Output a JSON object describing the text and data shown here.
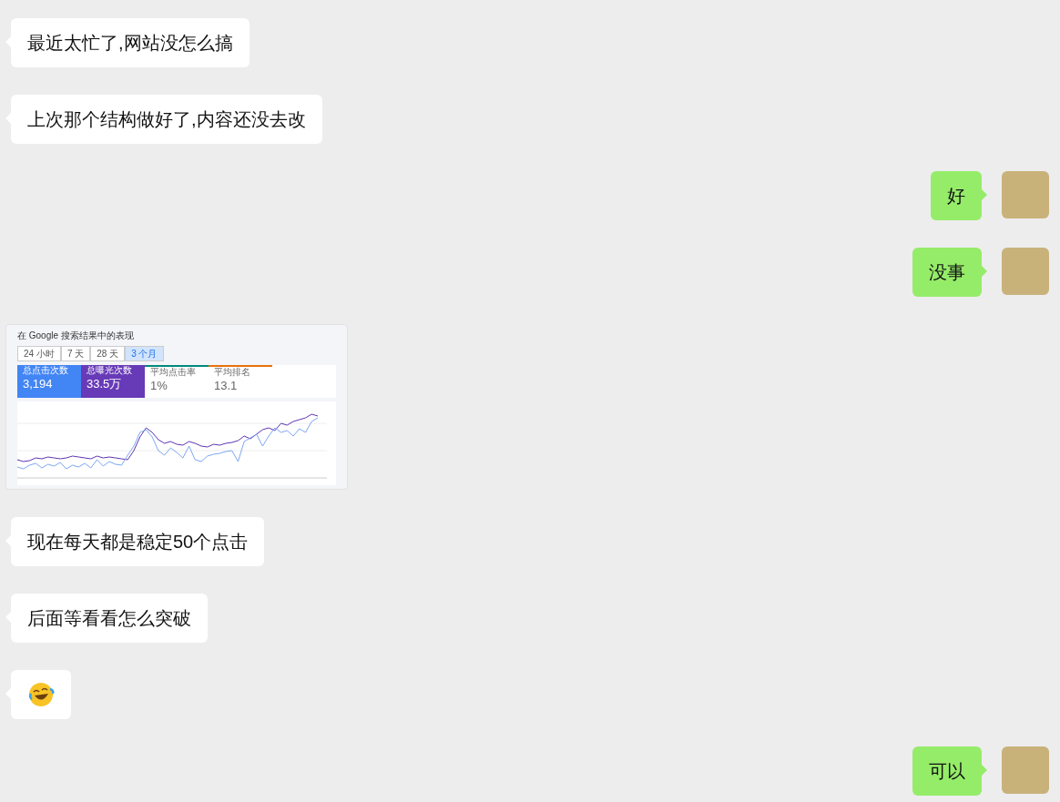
{
  "messages": [
    {
      "kind": "text",
      "sent": false,
      "text": "最近太忙了,网站没怎么搞"
    },
    {
      "kind": "text",
      "sent": false,
      "text": "上次那个结构做好了,内容还没去改"
    },
    {
      "kind": "text",
      "sent": true,
      "text": "好"
    },
    {
      "kind": "text",
      "sent": true,
      "text": "没事"
    },
    {
      "kind": "image",
      "sent": false,
      "shot": {
        "title": "在 Google 搜索结果中的表现",
        "ranges": [
          {
            "label": "24 小时",
            "selected": false
          },
          {
            "label": "7 天",
            "selected": false
          },
          {
            "label": "28 天",
            "selected": false
          },
          {
            "label": "3 个月",
            "selected": true
          }
        ],
        "metrics": [
          {
            "label": "总点击次数",
            "value": "3,194",
            "checked": true,
            "color": "#4285f4"
          },
          {
            "label": "总曝光次数",
            "value": "33.5万",
            "checked": true,
            "color": "#673ab7"
          },
          {
            "label": "平均点击率",
            "value": "1%",
            "checked": false,
            "color": "#00897b"
          },
          {
            "label": "平均排名",
            "value": "13.1",
            "checked": false,
            "color": "#e8710a"
          }
        ]
      }
    },
    {
      "kind": "text",
      "sent": false,
      "text": "现在每天都是稳定50个点击"
    },
    {
      "kind": "text",
      "sent": false,
      "text": "后面等看看怎么突破"
    },
    {
      "kind": "emoji",
      "sent": false
    },
    {
      "kind": "text",
      "sent": true,
      "text": "可以"
    }
  ]
}
